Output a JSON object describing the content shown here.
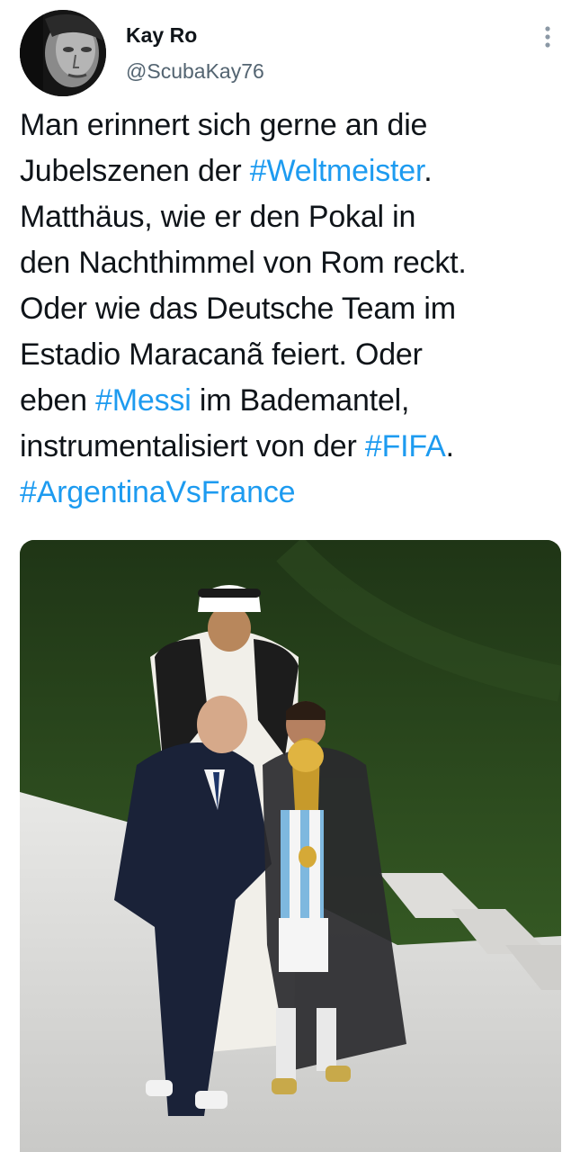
{
  "author": {
    "name": "Kay Ro",
    "handle": "@ScubaKay76",
    "avatar_icon": "profile-photo"
  },
  "more_icon": "more-vertical-icon",
  "tweet": {
    "lines": [
      [
        {
          "text": "Man erinnert sich gerne an die",
          "hashtag": false
        }
      ],
      [
        {
          "text": "Jubelszenen der ",
          "hashtag": false
        },
        {
          "text": "#Weltmeister",
          "hashtag": true
        },
        {
          "text": ".",
          "hashtag": false
        }
      ],
      [
        {
          "text": "Matthäus, wie er den Pokal in",
          "hashtag": false
        }
      ],
      [
        {
          "text": "den Nachthimmel von Rom reckt.",
          "hashtag": false
        }
      ],
      [
        {
          "text": "Oder wie das Deutsche Team im",
          "hashtag": false
        }
      ],
      [
        {
          "text": "Estadio Maracanã feiert. Oder",
          "hashtag": false
        }
      ],
      [
        {
          "text": "eben ",
          "hashtag": false
        },
        {
          "text": "#Messi",
          "hashtag": true
        },
        {
          "text": " im Bademantel,",
          "hashtag": false
        }
      ],
      [
        {
          "text": "instrumentalisiert von der ",
          "hashtag": false
        },
        {
          "text": "#FIFA",
          "hashtag": true
        },
        {
          "text": ".",
          "hashtag": false
        }
      ],
      [
        {
          "text": "#ArgentinaVsFrance",
          "hashtag": true
        }
      ]
    ]
  },
  "media": {
    "kind": "photo",
    "subject": "world-cup-trophy-ceremony"
  },
  "colors": {
    "text": "#0f1419",
    "secondary": "#536471",
    "link": "#1d9bf0",
    "background": "#ffffff"
  }
}
